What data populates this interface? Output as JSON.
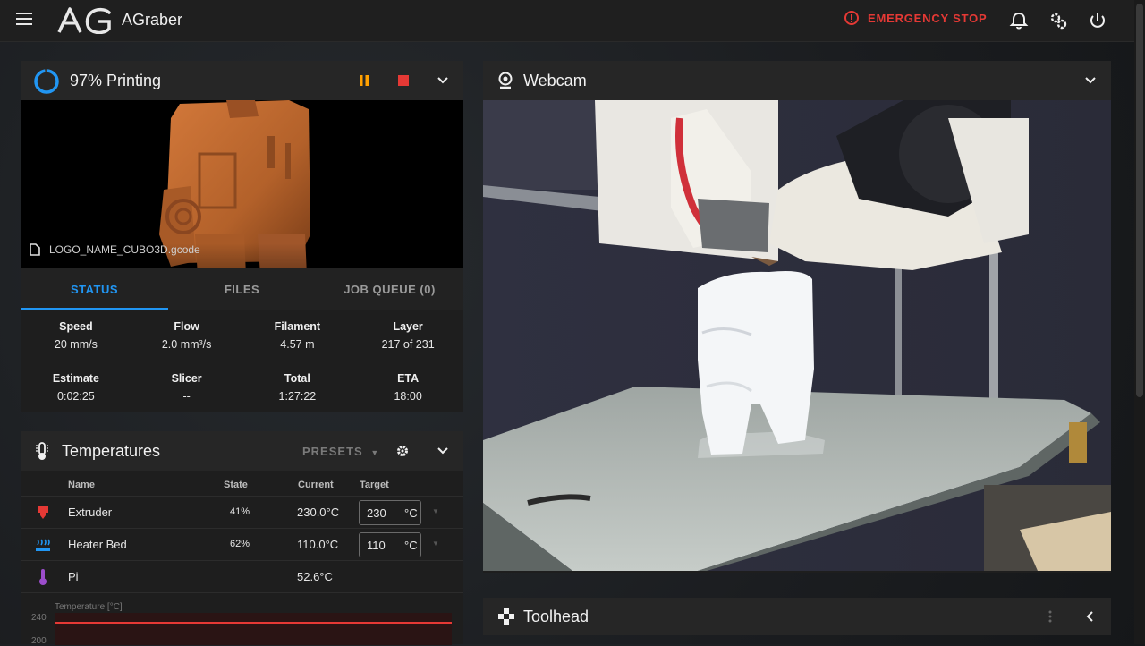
{
  "app": {
    "title": "AGraber",
    "logo_text": "AG"
  },
  "topbar": {
    "emergency_stop": "EMERGENCY STOP"
  },
  "job": {
    "status_title": "97% Printing",
    "progress": 0.97,
    "filename": "LOGO_NAME_CUBO3D.gcode",
    "tabs": [
      "STATUS",
      "FILES",
      "JOB QUEUE (0)"
    ],
    "stats": [
      {
        "label": "Speed",
        "value": "20 mm/s"
      },
      {
        "label": "Flow",
        "value": "2.0 mm³/s"
      },
      {
        "label": "Filament",
        "value": "4.57 m"
      },
      {
        "label": "Layer",
        "value": "217 of 231"
      },
      {
        "label": "Estimate",
        "value": "0:02:25"
      },
      {
        "label": "Slicer",
        "value": "--"
      },
      {
        "label": "Total",
        "value": "1:27:22"
      },
      {
        "label": "ETA",
        "value": "18:00"
      }
    ]
  },
  "temperatures": {
    "title": "Temperatures",
    "presets": "PRESETS",
    "columns": {
      "name": "Name",
      "state": "State",
      "current": "Current",
      "target": "Target"
    },
    "rows": [
      {
        "name": "Extruder",
        "state": "41%",
        "current": "230.0°C",
        "target": "230",
        "unit": "°C"
      },
      {
        "name": "Heater Bed",
        "state": "62%",
        "current": "110.0°C",
        "target": "110",
        "unit": "°C"
      },
      {
        "name": "Pi",
        "state": "",
        "current": "52.6°C",
        "target": "",
        "unit": ""
      }
    ],
    "chart": {
      "ylabel": "Temperature [°C]",
      "ticks": [
        "240",
        "200"
      ]
    }
  },
  "webcam": {
    "title": "Webcam"
  },
  "toolhead": {
    "title": "Toolhead"
  },
  "colors": {
    "accent": "#2196f3",
    "danger": "#e53935",
    "warning": "#ffa000"
  }
}
